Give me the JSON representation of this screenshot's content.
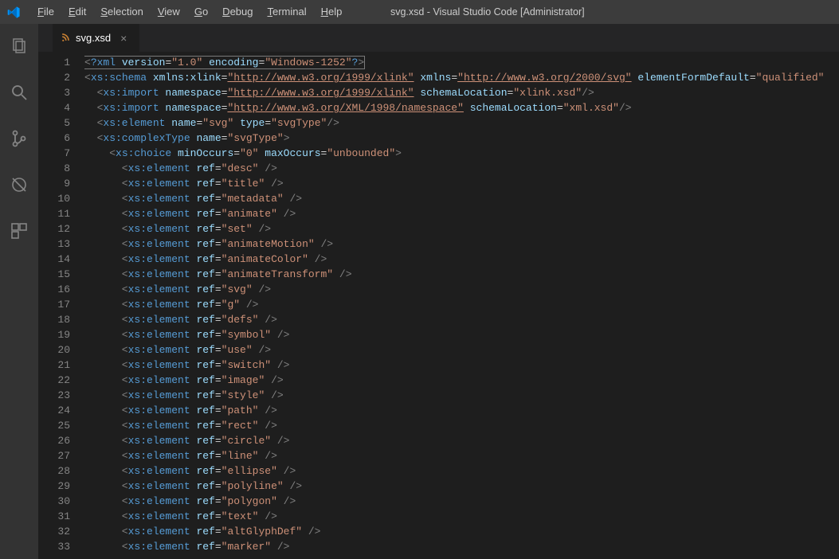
{
  "title": "svg.xsd - Visual Studio Code [Administrator]",
  "menu": [
    "File",
    "Edit",
    "Selection",
    "View",
    "Go",
    "Debug",
    "Terminal",
    "Help"
  ],
  "tab": {
    "icon": "⧉",
    "label": "svg.xsd",
    "close": "×"
  },
  "gutter": [
    "1",
    "2",
    "3",
    "4",
    "5",
    "6",
    "7",
    "8",
    "9",
    "10",
    "11",
    "12",
    "13",
    "14",
    "15",
    "16",
    "17",
    "18",
    "19",
    "20",
    "21",
    "22",
    "23",
    "24",
    "25",
    "26",
    "27",
    "28",
    "29",
    "30",
    "31",
    "32",
    "33"
  ],
  "lines": [
    [
      {
        "c": "t-br",
        "t": "<"
      },
      {
        "c": "t-pi",
        "t": "?xml "
      },
      {
        "c": "t-attr",
        "t": "version"
      },
      {
        "c": "t-eq",
        "t": "="
      },
      {
        "c": "t-str",
        "t": "\"1.0\""
      },
      {
        "c": "t-eq",
        "t": " "
      },
      {
        "c": "t-attr",
        "t": "encoding"
      },
      {
        "c": "t-eq",
        "t": "="
      },
      {
        "c": "t-str",
        "t": "\"Windows-1252\""
      },
      {
        "c": "t-pi",
        "t": "?"
      },
      {
        "c": "t-br",
        "t": ">"
      }
    ],
    [
      {
        "c": "t-br",
        "t": "<"
      },
      {
        "c": "t-tag",
        "t": "xs:schema "
      },
      {
        "c": "t-attr",
        "t": "xmlns:xlink"
      },
      {
        "c": "t-eq",
        "t": "="
      },
      {
        "c": "t-link",
        "t": "\"http://www.w3.org/1999/xlink\""
      },
      {
        "c": "t-eq",
        "t": " "
      },
      {
        "c": "t-attr",
        "t": "xmlns"
      },
      {
        "c": "t-eq",
        "t": "="
      },
      {
        "c": "t-link",
        "t": "\"http://www.w3.org/2000/svg\""
      },
      {
        "c": "t-eq",
        "t": " "
      },
      {
        "c": "t-attr",
        "t": "elementFormDefault"
      },
      {
        "c": "t-eq",
        "t": "="
      },
      {
        "c": "t-str",
        "t": "\"qualified\""
      }
    ],
    [
      {
        "c": "t-br",
        "t": "  <"
      },
      {
        "c": "t-tag",
        "t": "xs:import "
      },
      {
        "c": "t-attr",
        "t": "namespace"
      },
      {
        "c": "t-eq",
        "t": "="
      },
      {
        "c": "t-link",
        "t": "\"http://www.w3.org/1999/xlink\""
      },
      {
        "c": "t-eq",
        "t": " "
      },
      {
        "c": "t-attr",
        "t": "schemaLocation"
      },
      {
        "c": "t-eq",
        "t": "="
      },
      {
        "c": "t-str",
        "t": "\"xlink.xsd\""
      },
      {
        "c": "t-br",
        "t": "/>"
      }
    ],
    [
      {
        "c": "t-br",
        "t": "  <"
      },
      {
        "c": "t-tag",
        "t": "xs:import "
      },
      {
        "c": "t-attr",
        "t": "namespace"
      },
      {
        "c": "t-eq",
        "t": "="
      },
      {
        "c": "t-link",
        "t": "\"http://www.w3.org/XML/1998/namespace\""
      },
      {
        "c": "t-eq",
        "t": " "
      },
      {
        "c": "t-attr",
        "t": "schemaLocation"
      },
      {
        "c": "t-eq",
        "t": "="
      },
      {
        "c": "t-str",
        "t": "\"xml.xsd\""
      },
      {
        "c": "t-br",
        "t": "/>"
      }
    ],
    [
      {
        "c": "t-br",
        "t": "  <"
      },
      {
        "c": "t-tag",
        "t": "xs:element "
      },
      {
        "c": "t-attr",
        "t": "name"
      },
      {
        "c": "t-eq",
        "t": "="
      },
      {
        "c": "t-str",
        "t": "\"svg\""
      },
      {
        "c": "t-eq",
        "t": " "
      },
      {
        "c": "t-attr",
        "t": "type"
      },
      {
        "c": "t-eq",
        "t": "="
      },
      {
        "c": "t-str",
        "t": "\"svgType\""
      },
      {
        "c": "t-br",
        "t": "/>"
      }
    ],
    [
      {
        "c": "t-br",
        "t": "  <"
      },
      {
        "c": "t-tag",
        "t": "xs:complexType "
      },
      {
        "c": "t-attr",
        "t": "name"
      },
      {
        "c": "t-eq",
        "t": "="
      },
      {
        "c": "t-str",
        "t": "\"svgType\""
      },
      {
        "c": "t-br",
        "t": ">"
      }
    ],
    [
      {
        "c": "t-br",
        "t": "    <"
      },
      {
        "c": "t-tag",
        "t": "xs:choice "
      },
      {
        "c": "t-attr",
        "t": "minOccurs"
      },
      {
        "c": "t-eq",
        "t": "="
      },
      {
        "c": "t-str",
        "t": "\"0\""
      },
      {
        "c": "t-eq",
        "t": " "
      },
      {
        "c": "t-attr",
        "t": "maxOccurs"
      },
      {
        "c": "t-eq",
        "t": "="
      },
      {
        "c": "t-str",
        "t": "\"unbounded\""
      },
      {
        "c": "t-br",
        "t": ">"
      }
    ],
    [
      {
        "c": "t-br",
        "t": "      <"
      },
      {
        "c": "t-tag",
        "t": "xs:element "
      },
      {
        "c": "t-attr",
        "t": "ref"
      },
      {
        "c": "t-eq",
        "t": "="
      },
      {
        "c": "t-str",
        "t": "\"desc\""
      },
      {
        "c": "t-br",
        "t": " />"
      }
    ],
    [
      {
        "c": "t-br",
        "t": "      <"
      },
      {
        "c": "t-tag",
        "t": "xs:element "
      },
      {
        "c": "t-attr",
        "t": "ref"
      },
      {
        "c": "t-eq",
        "t": "="
      },
      {
        "c": "t-str",
        "t": "\"title\""
      },
      {
        "c": "t-br",
        "t": " />"
      }
    ],
    [
      {
        "c": "t-br",
        "t": "      <"
      },
      {
        "c": "t-tag",
        "t": "xs:element "
      },
      {
        "c": "t-attr",
        "t": "ref"
      },
      {
        "c": "t-eq",
        "t": "="
      },
      {
        "c": "t-str",
        "t": "\"metadata\""
      },
      {
        "c": "t-br",
        "t": " />"
      }
    ],
    [
      {
        "c": "t-br",
        "t": "      <"
      },
      {
        "c": "t-tag",
        "t": "xs:element "
      },
      {
        "c": "t-attr",
        "t": "ref"
      },
      {
        "c": "t-eq",
        "t": "="
      },
      {
        "c": "t-str",
        "t": "\"animate\""
      },
      {
        "c": "t-br",
        "t": " />"
      }
    ],
    [
      {
        "c": "t-br",
        "t": "      <"
      },
      {
        "c": "t-tag",
        "t": "xs:element "
      },
      {
        "c": "t-attr",
        "t": "ref"
      },
      {
        "c": "t-eq",
        "t": "="
      },
      {
        "c": "t-str",
        "t": "\"set\""
      },
      {
        "c": "t-br",
        "t": " />"
      }
    ],
    [
      {
        "c": "t-br",
        "t": "      <"
      },
      {
        "c": "t-tag",
        "t": "xs:element "
      },
      {
        "c": "t-attr",
        "t": "ref"
      },
      {
        "c": "t-eq",
        "t": "="
      },
      {
        "c": "t-str",
        "t": "\"animateMotion\""
      },
      {
        "c": "t-br",
        "t": " />"
      }
    ],
    [
      {
        "c": "t-br",
        "t": "      <"
      },
      {
        "c": "t-tag",
        "t": "xs:element "
      },
      {
        "c": "t-attr",
        "t": "ref"
      },
      {
        "c": "t-eq",
        "t": "="
      },
      {
        "c": "t-str",
        "t": "\"animateColor\""
      },
      {
        "c": "t-br",
        "t": " />"
      }
    ],
    [
      {
        "c": "t-br",
        "t": "      <"
      },
      {
        "c": "t-tag",
        "t": "xs:element "
      },
      {
        "c": "t-attr",
        "t": "ref"
      },
      {
        "c": "t-eq",
        "t": "="
      },
      {
        "c": "t-str",
        "t": "\"animateTransform\""
      },
      {
        "c": "t-br",
        "t": " />"
      }
    ],
    [
      {
        "c": "t-br",
        "t": "      <"
      },
      {
        "c": "t-tag",
        "t": "xs:element "
      },
      {
        "c": "t-attr",
        "t": "ref"
      },
      {
        "c": "t-eq",
        "t": "="
      },
      {
        "c": "t-str",
        "t": "\"svg\""
      },
      {
        "c": "t-br",
        "t": " />"
      }
    ],
    [
      {
        "c": "t-br",
        "t": "      <"
      },
      {
        "c": "t-tag",
        "t": "xs:element "
      },
      {
        "c": "t-attr",
        "t": "ref"
      },
      {
        "c": "t-eq",
        "t": "="
      },
      {
        "c": "t-str",
        "t": "\"g\""
      },
      {
        "c": "t-br",
        "t": " />"
      }
    ],
    [
      {
        "c": "t-br",
        "t": "      <"
      },
      {
        "c": "t-tag",
        "t": "xs:element "
      },
      {
        "c": "t-attr",
        "t": "ref"
      },
      {
        "c": "t-eq",
        "t": "="
      },
      {
        "c": "t-str",
        "t": "\"defs\""
      },
      {
        "c": "t-br",
        "t": " />"
      }
    ],
    [
      {
        "c": "t-br",
        "t": "      <"
      },
      {
        "c": "t-tag",
        "t": "xs:element "
      },
      {
        "c": "t-attr",
        "t": "ref"
      },
      {
        "c": "t-eq",
        "t": "="
      },
      {
        "c": "t-str",
        "t": "\"symbol\""
      },
      {
        "c": "t-br",
        "t": " />"
      }
    ],
    [
      {
        "c": "t-br",
        "t": "      <"
      },
      {
        "c": "t-tag",
        "t": "xs:element "
      },
      {
        "c": "t-attr",
        "t": "ref"
      },
      {
        "c": "t-eq",
        "t": "="
      },
      {
        "c": "t-str",
        "t": "\"use\""
      },
      {
        "c": "t-br",
        "t": " />"
      }
    ],
    [
      {
        "c": "t-br",
        "t": "      <"
      },
      {
        "c": "t-tag",
        "t": "xs:element "
      },
      {
        "c": "t-attr",
        "t": "ref"
      },
      {
        "c": "t-eq",
        "t": "="
      },
      {
        "c": "t-str",
        "t": "\"switch\""
      },
      {
        "c": "t-br",
        "t": " />"
      }
    ],
    [
      {
        "c": "t-br",
        "t": "      <"
      },
      {
        "c": "t-tag",
        "t": "xs:element "
      },
      {
        "c": "t-attr",
        "t": "ref"
      },
      {
        "c": "t-eq",
        "t": "="
      },
      {
        "c": "t-str",
        "t": "\"image\""
      },
      {
        "c": "t-br",
        "t": " />"
      }
    ],
    [
      {
        "c": "t-br",
        "t": "      <"
      },
      {
        "c": "t-tag",
        "t": "xs:element "
      },
      {
        "c": "t-attr",
        "t": "ref"
      },
      {
        "c": "t-eq",
        "t": "="
      },
      {
        "c": "t-str",
        "t": "\"style\""
      },
      {
        "c": "t-br",
        "t": " />"
      }
    ],
    [
      {
        "c": "t-br",
        "t": "      <"
      },
      {
        "c": "t-tag",
        "t": "xs:element "
      },
      {
        "c": "t-attr",
        "t": "ref"
      },
      {
        "c": "t-eq",
        "t": "="
      },
      {
        "c": "t-str",
        "t": "\"path\""
      },
      {
        "c": "t-br",
        "t": " />"
      }
    ],
    [
      {
        "c": "t-br",
        "t": "      <"
      },
      {
        "c": "t-tag",
        "t": "xs:element "
      },
      {
        "c": "t-attr",
        "t": "ref"
      },
      {
        "c": "t-eq",
        "t": "="
      },
      {
        "c": "t-str",
        "t": "\"rect\""
      },
      {
        "c": "t-br",
        "t": " />"
      }
    ],
    [
      {
        "c": "t-br",
        "t": "      <"
      },
      {
        "c": "t-tag",
        "t": "xs:element "
      },
      {
        "c": "t-attr",
        "t": "ref"
      },
      {
        "c": "t-eq",
        "t": "="
      },
      {
        "c": "t-str",
        "t": "\"circle\""
      },
      {
        "c": "t-br",
        "t": " />"
      }
    ],
    [
      {
        "c": "t-br",
        "t": "      <"
      },
      {
        "c": "t-tag",
        "t": "xs:element "
      },
      {
        "c": "t-attr",
        "t": "ref"
      },
      {
        "c": "t-eq",
        "t": "="
      },
      {
        "c": "t-str",
        "t": "\"line\""
      },
      {
        "c": "t-br",
        "t": " />"
      }
    ],
    [
      {
        "c": "t-br",
        "t": "      <"
      },
      {
        "c": "t-tag",
        "t": "xs:element "
      },
      {
        "c": "t-attr",
        "t": "ref"
      },
      {
        "c": "t-eq",
        "t": "="
      },
      {
        "c": "t-str",
        "t": "\"ellipse\""
      },
      {
        "c": "t-br",
        "t": " />"
      }
    ],
    [
      {
        "c": "t-br",
        "t": "      <"
      },
      {
        "c": "t-tag",
        "t": "xs:element "
      },
      {
        "c": "t-attr",
        "t": "ref"
      },
      {
        "c": "t-eq",
        "t": "="
      },
      {
        "c": "t-str",
        "t": "\"polyline\""
      },
      {
        "c": "t-br",
        "t": " />"
      }
    ],
    [
      {
        "c": "t-br",
        "t": "      <"
      },
      {
        "c": "t-tag",
        "t": "xs:element "
      },
      {
        "c": "t-attr",
        "t": "ref"
      },
      {
        "c": "t-eq",
        "t": "="
      },
      {
        "c": "t-str",
        "t": "\"polygon\""
      },
      {
        "c": "t-br",
        "t": " />"
      }
    ],
    [
      {
        "c": "t-br",
        "t": "      <"
      },
      {
        "c": "t-tag",
        "t": "xs:element "
      },
      {
        "c": "t-attr",
        "t": "ref"
      },
      {
        "c": "t-eq",
        "t": "="
      },
      {
        "c": "t-str",
        "t": "\"text\""
      },
      {
        "c": "t-br",
        "t": " />"
      }
    ],
    [
      {
        "c": "t-br",
        "t": "      <"
      },
      {
        "c": "t-tag",
        "t": "xs:element "
      },
      {
        "c": "t-attr",
        "t": "ref"
      },
      {
        "c": "t-eq",
        "t": "="
      },
      {
        "c": "t-str",
        "t": "\"altGlyphDef\""
      },
      {
        "c": "t-br",
        "t": " />"
      }
    ],
    [
      {
        "c": "t-br",
        "t": "      <"
      },
      {
        "c": "t-tag",
        "t": "xs:element "
      },
      {
        "c": "t-attr",
        "t": "ref"
      },
      {
        "c": "t-eq",
        "t": "="
      },
      {
        "c": "t-str",
        "t": "\"marker\""
      },
      {
        "c": "t-br",
        "t": " />"
      }
    ]
  ]
}
